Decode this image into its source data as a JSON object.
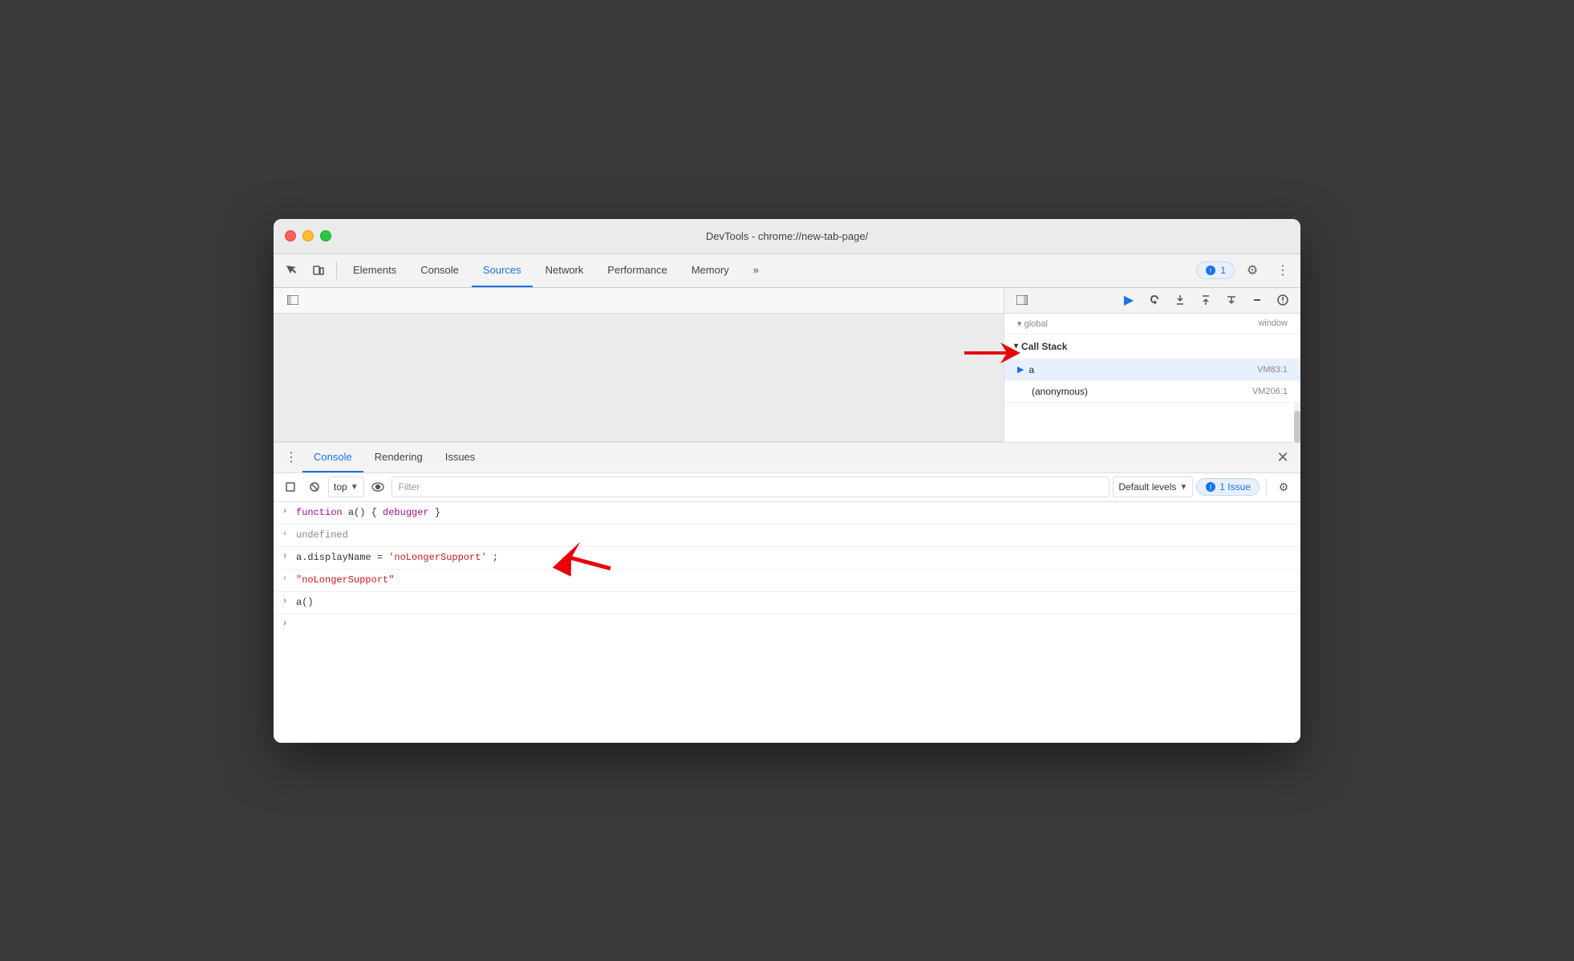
{
  "window": {
    "title": "DevTools - chrome://new-tab-page/"
  },
  "traffic_lights": {
    "red": "close",
    "yellow": "minimize",
    "green": "maximize"
  },
  "toolbar": {
    "tabs": [
      {
        "id": "elements",
        "label": "Elements",
        "active": false
      },
      {
        "id": "console",
        "label": "Console",
        "active": false
      },
      {
        "id": "sources",
        "label": "Sources",
        "active": true
      },
      {
        "id": "network",
        "label": "Network",
        "active": false
      },
      {
        "id": "performance",
        "label": "Performance",
        "active": false
      },
      {
        "id": "memory",
        "label": "Memory",
        "active": false
      }
    ],
    "more_tabs": "»",
    "issues_count": "1",
    "issues_label": "1"
  },
  "debug_toolbar": {
    "resume_label": "Resume script execution",
    "step_over_label": "Step over",
    "step_into_label": "Step into",
    "step_out_label": "Step out",
    "step_label": "Step",
    "deactivate_label": "Deactivate breakpoints",
    "pause_label": "Pause on exceptions"
  },
  "call_stack": {
    "header": "Call Stack",
    "global_label": "global",
    "global_value": "window",
    "frames": [
      {
        "name": "a",
        "location": "VM83:1",
        "active": true
      },
      {
        "name": "(anonymous)",
        "location": "VM206:1",
        "active": false
      }
    ]
  },
  "console_panel": {
    "tabs": [
      {
        "id": "console",
        "label": "Console",
        "active": true
      },
      {
        "id": "rendering",
        "label": "Rendering",
        "active": false
      },
      {
        "id": "issues",
        "label": "Issues",
        "active": false
      }
    ],
    "toolbar": {
      "context": "top",
      "filter_placeholder": "Filter",
      "levels_label": "Default levels",
      "issues_label": "1 Issue",
      "issues_icon": "🔵"
    },
    "lines": [
      {
        "type": "input",
        "content_html": "<span class=\"kw-function\">function</span> a() { <span class=\"kw-debugger\">debugger</span> }"
      },
      {
        "type": "output",
        "content": "undefined"
      },
      {
        "type": "input",
        "content_html": "a.displayName = <span class=\"str-val\">'noLongerSupport'</span>;"
      },
      {
        "type": "output",
        "content_html": "<span class=\"str-val\">\"noLongerSupport\"</span>"
      },
      {
        "type": "input",
        "content": "a()"
      }
    ]
  }
}
